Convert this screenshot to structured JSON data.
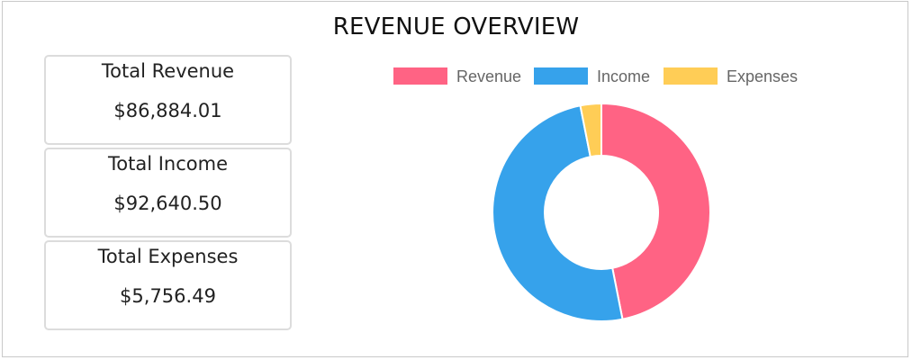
{
  "header": {
    "title": "REVENUE OVERVIEW"
  },
  "cards": [
    {
      "label": "Total Revenue",
      "value": "$86,884.01"
    },
    {
      "label": "Total Income",
      "value": "$92,640.50"
    },
    {
      "label": "Total Expenses",
      "value": "$5,756.49"
    }
  ],
  "chart_data": {
    "type": "doughnut",
    "legend_position": "top",
    "categories": [
      "Revenue",
      "Income",
      "Expenses"
    ],
    "values": [
      86884.01,
      92640.5,
      5756.49
    ],
    "colors": [
      "#ff6384",
      "#36a2eb",
      "#ffcd56"
    ],
    "start_angle": "12 o'clock, clockwise"
  }
}
